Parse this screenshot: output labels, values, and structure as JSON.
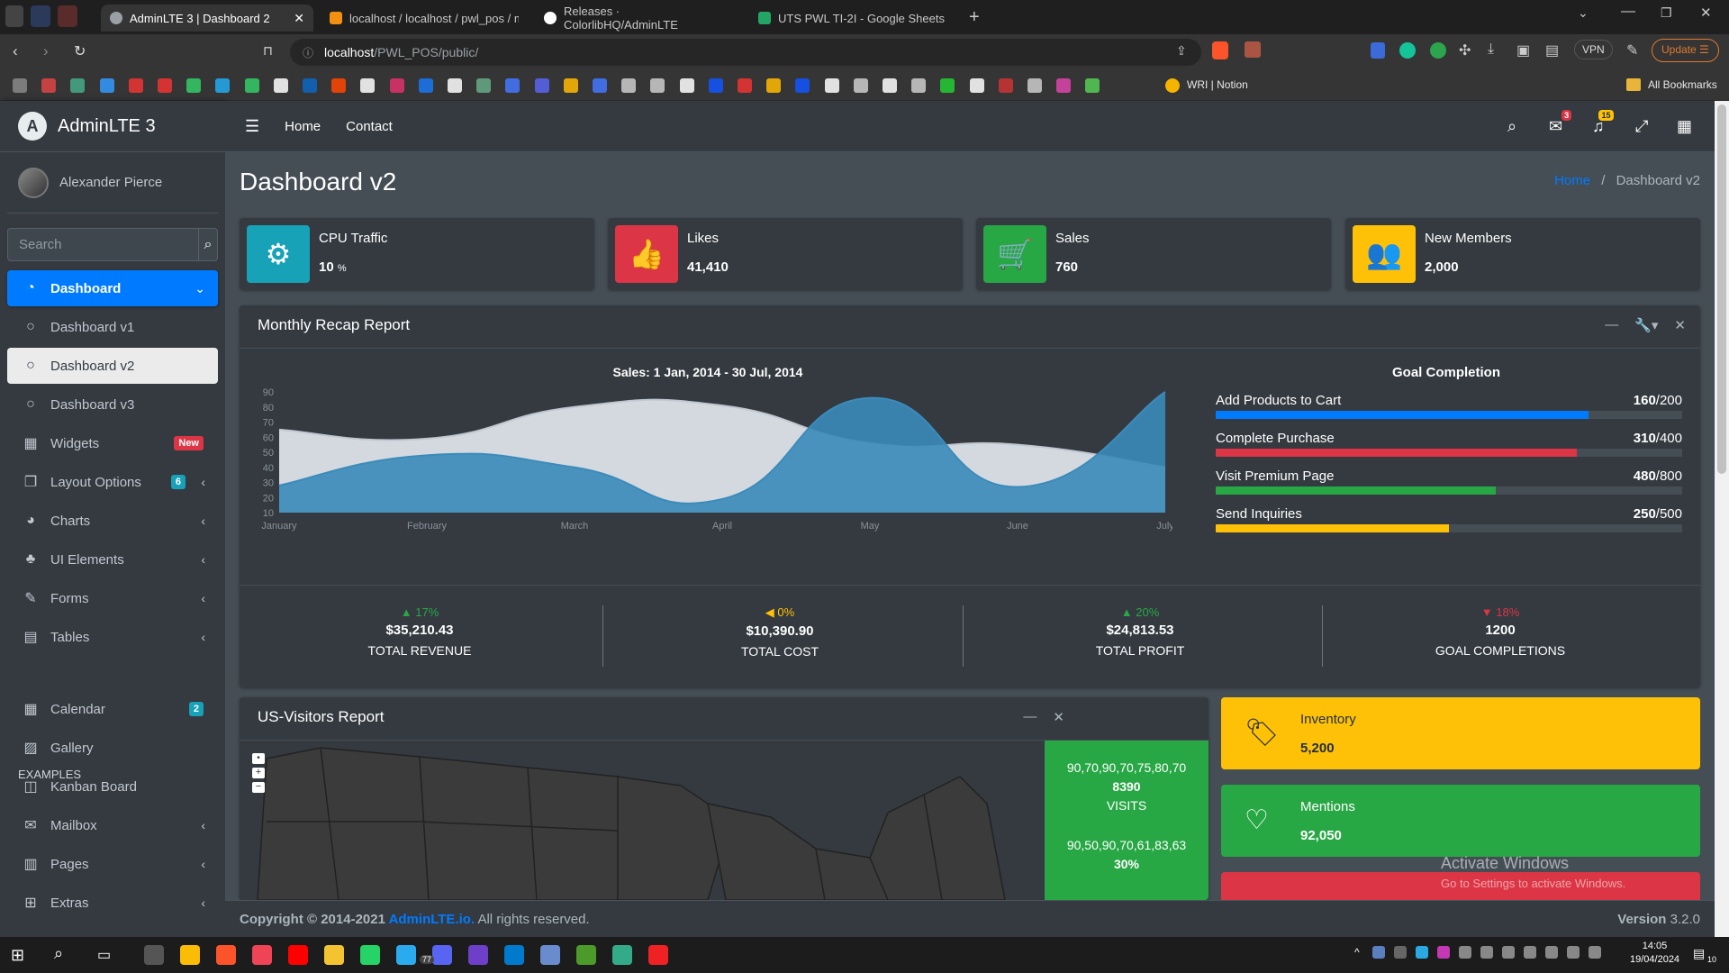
{
  "browser": {
    "tabs": [
      {
        "title": "AdminLTE 3 | Dashboard 2",
        "color": "#9aa0a6"
      },
      {
        "title": "localhost / localhost / pwl_pos / m_l",
        "color": "#f29111"
      },
      {
        "title": "Releases · ColorlibHQ/AdminLTE",
        "color": "#ffffff"
      },
      {
        "title": "UTS PWL TI-2I - Google Sheets",
        "color": "#23a566"
      }
    ],
    "url_host": "localhost",
    "url_path": "/PWL_POS/public/",
    "vpn_label": "VPN",
    "update_label": "Update",
    "bookmark_notion": "WRI | Notion",
    "all_bookmarks": "All Bookmarks"
  },
  "sidebar": {
    "brand": "AdminLTE 3",
    "user": "Alexander Pierce",
    "search_placeholder": "Search",
    "items": [
      {
        "label": "Dashboard",
        "icon": "tachometer-icon"
      },
      {
        "label": "Dashboard v1"
      },
      {
        "label": "Dashboard v2"
      },
      {
        "label": "Dashboard v3"
      },
      {
        "label": "Widgets",
        "badge": "New"
      },
      {
        "label": "Layout Options",
        "badge": "6"
      },
      {
        "label": "Charts"
      },
      {
        "label": "UI Elements"
      },
      {
        "label": "Forms"
      },
      {
        "label": "Tables"
      }
    ],
    "examples_header": "EXAMPLES",
    "examples": [
      {
        "label": "Calendar",
        "badge": "2"
      },
      {
        "label": "Gallery"
      },
      {
        "label": "Kanban Board"
      },
      {
        "label": "Mailbox"
      },
      {
        "label": "Pages"
      },
      {
        "label": "Extras"
      }
    ]
  },
  "topnav": {
    "home": "Home",
    "contact": "Contact",
    "messages_badge": "3",
    "notifications_badge": "15"
  },
  "page": {
    "title": "Dashboard v2",
    "breadcrumb_home": "Home",
    "breadcrumb_current": "Dashboard v2"
  },
  "info_boxes": [
    {
      "title": "CPU Traffic",
      "value": "10",
      "unit": "%",
      "color": "#17a2b8"
    },
    {
      "title": "Likes",
      "value": "41,410",
      "color": "#dc3545"
    },
    {
      "title": "Sales",
      "value": "760",
      "color": "#28a745"
    },
    {
      "title": "New Members",
      "value": "2,000",
      "color": "#ffc107"
    }
  ],
  "recap": {
    "header": "Monthly Recap Report",
    "chart_title": "Sales: 1 Jan, 2014 - 30 Jul, 2014",
    "goal_title": "Goal Completion",
    "goals": [
      {
        "label": "Add Products to Cart",
        "value": "160",
        "total": "/200",
        "fraction": 0.8,
        "color": "#007bff"
      },
      {
        "label": "Complete Purchase",
        "value": "310",
        "total": "/400",
        "fraction": 0.775,
        "color": "#dc3545"
      },
      {
        "label": "Visit Premium Page",
        "value": "480",
        "total": "/800",
        "fraction": 0.6,
        "color": "#28a745"
      },
      {
        "label": "Send Inquiries",
        "value": "250",
        "total": "/500",
        "fraction": 0.5,
        "color": "#ffc107"
      }
    ],
    "footer": [
      {
        "pct": "17%",
        "arrow": "▲",
        "color": "#28a745",
        "amount": "$35,210.43",
        "label": "TOTAL REVENUE"
      },
      {
        "pct": "0%",
        "arrow": "◀",
        "color": "#ffc107",
        "amount": "$10,390.90",
        "label": "TOTAL COST"
      },
      {
        "pct": "20%",
        "arrow": "▲",
        "color": "#28a745",
        "amount": "$24,813.53",
        "label": "TOTAL PROFIT"
      },
      {
        "pct": "18%",
        "arrow": "▼",
        "color": "#dc3545",
        "amount": "1200",
        "label": "GOAL COMPLETIONS"
      }
    ]
  },
  "chart_data": {
    "type": "area",
    "title": "Sales: 1 Jan, 2014 - 30 Jul, 2014",
    "categories": [
      "January",
      "February",
      "March",
      "April",
      "May",
      "June",
      "July"
    ],
    "ylim": [
      10,
      90
    ],
    "yticks": [
      "90",
      "80",
      "70",
      "60",
      "50",
      "40",
      "30",
      "20",
      "10"
    ],
    "series": [
      {
        "values": [
          65,
          59,
          80,
          81,
          56,
          55,
          40
        ],
        "color": "#dde0e8"
      },
      {
        "values": [
          28,
          48,
          40,
          19,
          86,
          27,
          90
        ],
        "color": "#3b8bba"
      }
    ]
  },
  "visitors": {
    "header": "US-Visitors Report",
    "zoom_labels": [
      "+",
      "+",
      "−"
    ],
    "stat1_spark": "90,70,90,70,75,80,70",
    "stat1_value": "8390",
    "stat1_label": "VISITS",
    "stat2_spark": "90,50,90,70,61,83,63",
    "stat2_value": "30%"
  },
  "smallboxes": [
    {
      "title": "Inventory",
      "value": "5,200",
      "color": "#ffc107",
      "text": "#1f2d3d",
      "icon": "tag-icon"
    },
    {
      "title": "Mentions",
      "value": "92,050",
      "color": "#28a745",
      "text": "#ffffff",
      "icon": "heart-icon"
    }
  ],
  "footer": {
    "copyright": "Copyright © 2014-2021 ",
    "link": "AdminLTE.io.",
    "rights": " All rights reserved.",
    "version_label": "Version",
    "version": " 3.2.0"
  },
  "watermark": {
    "title": "Activate Windows",
    "sub": "Go to Settings to activate Windows."
  },
  "taskbar": {
    "time": "14:05",
    "date": "19/04/2024",
    "notif_count": "10",
    "whatsapp_badge": "77"
  }
}
